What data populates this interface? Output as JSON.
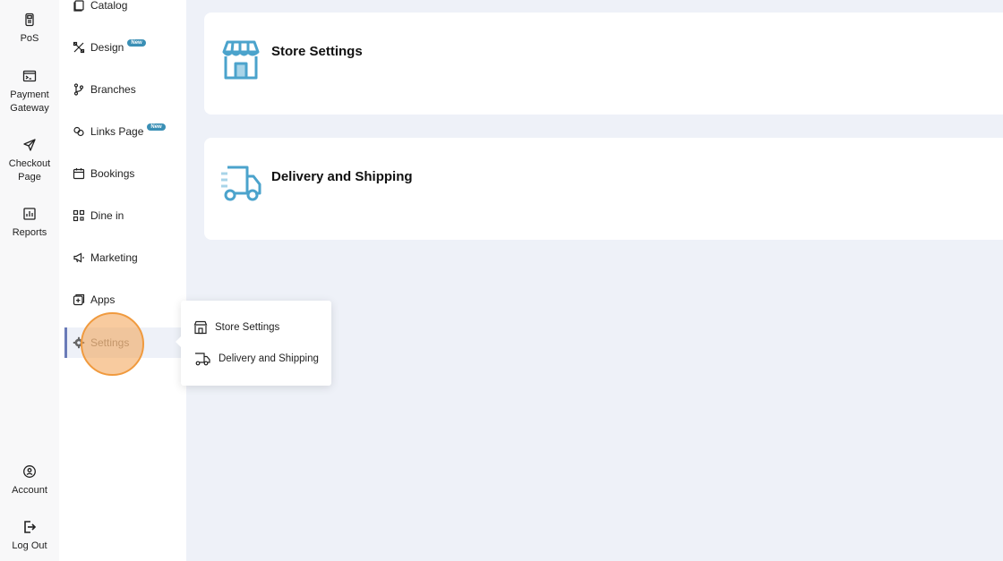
{
  "rail": {
    "items": [
      {
        "label": "PoS",
        "icon": "pos-device-icon"
      },
      {
        "label": "Payment Gateway",
        "icon": "terminal-icon"
      },
      {
        "label": "Checkout Page",
        "icon": "send-icon"
      },
      {
        "label": "Reports",
        "icon": "bar-chart-icon"
      },
      {
        "label": "Account",
        "icon": "account-icon"
      },
      {
        "label": "Log Out",
        "icon": "logout-icon"
      }
    ]
  },
  "nav": {
    "badge_text": "New",
    "items": [
      {
        "label": "Catalog",
        "icon": "catalog-icon"
      },
      {
        "label": "Design",
        "icon": "design-tools-icon",
        "badge": true
      },
      {
        "label": "Branches",
        "icon": "branches-icon"
      },
      {
        "label": "Links Page",
        "icon": "link-icon",
        "badge": true
      },
      {
        "label": "Bookings",
        "icon": "calendar-icon"
      },
      {
        "label": "Dine in",
        "icon": "qr-code-icon"
      },
      {
        "label": "Marketing",
        "icon": "megaphone-icon"
      },
      {
        "label": "Apps",
        "icon": "apps-icon"
      },
      {
        "label": "Settings",
        "icon": "gear-icon",
        "active": true
      }
    ]
  },
  "cards": [
    {
      "title": "Store Settings",
      "icon": "storefront-icon"
    },
    {
      "title": "Delivery and Shipping",
      "icon": "delivery-truck-icon"
    }
  ],
  "popover": {
    "items": [
      {
        "label": "Store Settings",
        "icon": "storefront-icon"
      },
      {
        "label": "Delivery and Shipping",
        "icon": "delivery-truck-icon"
      }
    ]
  },
  "colors": {
    "accent_blue": "#4ba3cc",
    "badge": "#3a8fb5",
    "active_indicator": "#6a7bb8",
    "cursor_highlight": "#f09a3e",
    "page_background": "#eef1f8"
  }
}
